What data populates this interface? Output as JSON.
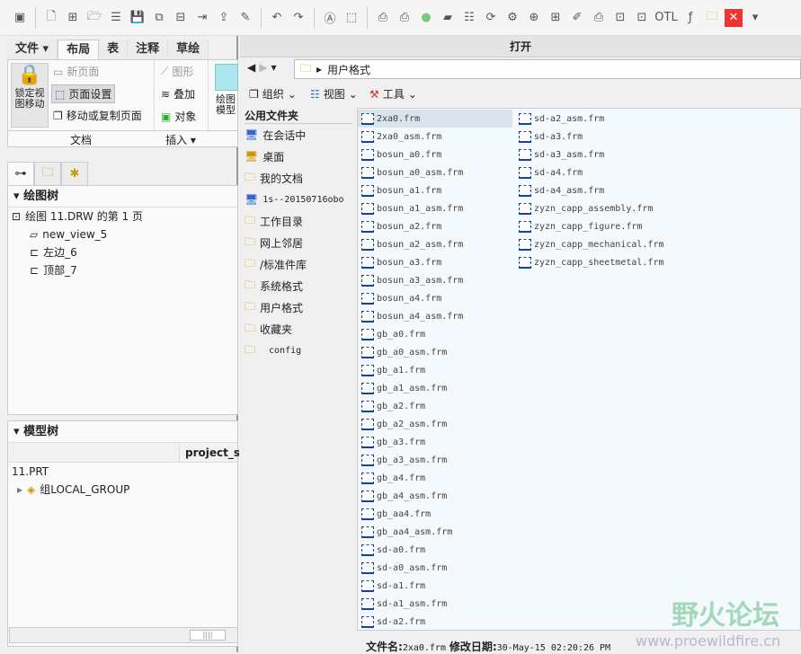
{
  "toolbar": {
    "icons": [
      "window-icon",
      "new-icon",
      "open-session-icon",
      "open-icon",
      "document-icon",
      "save-icon",
      "save-as-icon",
      "bom-icon",
      "backup-icon",
      "export-icon",
      "brush-icon",
      "undo-icon",
      "redo-icon",
      "text-icon",
      "select-box-icon",
      "print-icon",
      "print2-icon",
      "sphere-icon",
      "eraser-icon",
      "list-icon",
      "regenerate-icon",
      "gear-icon",
      "target-icon",
      "window-layout-icon",
      "edit-icon",
      "printer-icon",
      "params-icon",
      "params2-icon",
      "otl-icon",
      "fx-icon",
      "folder-icon",
      "close-icon",
      "more-icon"
    ],
    "otl_label": "OTL"
  },
  "ribbon": {
    "tabs": [
      "文件",
      "布局",
      "表",
      "注释",
      "草绘"
    ],
    "active_tab": "布局",
    "lock_view": "锁定视图移动",
    "new_page": "新页面",
    "page_setup": "页面设置",
    "move_copy_page": "移动或复制页面",
    "graphic": "图形",
    "overlay": "叠加",
    "object": "对象",
    "drawing_model": "绘图模型",
    "group_document": "文档",
    "group_insert": "插入"
  },
  "drawing_tree": {
    "title": "绘图树",
    "items": [
      "绘图 11.DRW 的第 1 页",
      "new_view_5",
      "左边_6",
      "顶部_7"
    ]
  },
  "model_tree": {
    "title": "模型树",
    "column": "project_sh",
    "root": "11.PRT",
    "items": [
      "组LOCAL_GROUP"
    ]
  },
  "dialog": {
    "title": "打开",
    "path": "用户格式",
    "organize": "组织",
    "view": "视图",
    "tools": "工具",
    "nav_header": "公用文件夹",
    "nav": [
      "在会话中",
      "桌面",
      "我的文档",
      "1s--20150716obo",
      "工作目录",
      "网上邻居",
      "/标准件库",
      "系统格式",
      "用户格式",
      "收藏夹",
      "config"
    ],
    "files_col1": [
      "2xa0.frm",
      "2xa0_asm.frm",
      "bosun_a0.frm",
      "bosun_a0_asm.frm",
      "bosun_a1.frm",
      "bosun_a1_asm.frm",
      "bosun_a2.frm",
      "bosun_a2_asm.frm",
      "bosun_a3.frm",
      "bosun_a3_asm.frm",
      "bosun_a4.frm",
      "bosun_a4_asm.frm",
      "gb_a0.frm",
      "gb_a0_asm.frm",
      "gb_a1.frm",
      "gb_a1_asm.frm",
      "gb_a2.frm",
      "gb_a2_asm.frm",
      "gb_a3.frm",
      "gb_a3_asm.frm",
      "gb_a4.frm",
      "gb_a4_asm.frm",
      "gb_aa4.frm",
      "gb_aa4_asm.frm",
      "sd-a0.frm",
      "sd-a0_asm.frm",
      "sd-a1.frm",
      "sd-a1_asm.frm",
      "sd-a2.frm"
    ],
    "files_col2": [
      "sd-a2_asm.frm",
      "sd-a3.frm",
      "sd-a3_asm.frm",
      "sd-a4.frm",
      "sd-a4_asm.frm",
      "zyzn_capp_assembly.frm",
      "zyzn_capp_figure.frm",
      "zyzn_capp_mechanical.frm",
      "zyzn_capp_sheetmetal.frm"
    ],
    "selected": "2xa0.frm",
    "status": {
      "filename_label": "文件名:",
      "filename": "2xa0.frm",
      "date_label": "修改日期:",
      "date": "30-May-15 02:20:26 PM"
    }
  },
  "watermark": {
    "title": "野火论坛",
    "url": "www.proewildfire.cn"
  }
}
